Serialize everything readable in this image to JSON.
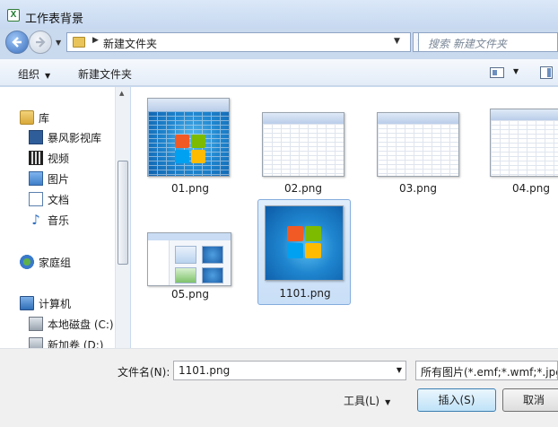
{
  "window": {
    "title": "工作表背景",
    "app_icon_text": "X"
  },
  "address": {
    "path": "新建文件夹",
    "search_placeholder": "搜索 新建文件夹"
  },
  "toolbar": {
    "organize": "组织",
    "new_folder": "新建文件夹"
  },
  "nav": {
    "library": "库",
    "items": [
      "暴风影视库",
      "视频",
      "图片",
      "文档",
      "音乐"
    ],
    "homegroup": "家庭组",
    "computer": "计算机",
    "drives": [
      "本地磁盘 (C:)",
      "新加卷 (D:)"
    ]
  },
  "files": [
    {
      "name": "01.png",
      "kind": "excel-windows"
    },
    {
      "name": "02.png",
      "kind": "excel"
    },
    {
      "name": "03.png",
      "kind": "excel"
    },
    {
      "name": "04.png",
      "kind": "excel"
    },
    {
      "name": "05.png",
      "kind": "explorer"
    },
    {
      "name": "1101.png",
      "kind": "windows",
      "selected": true
    }
  ],
  "bottom": {
    "filename_label": "文件名(N):",
    "filename_value": "1101.png",
    "filetype": "所有图片(*.emf;*.wmf;*.jpg;*.jpeg",
    "tools": "工具(L)",
    "insert": "插入(S)",
    "cancel": "取消"
  },
  "colors": {
    "accent": "#3c7fb1",
    "selection": "#c9dff7",
    "window_frame": "#c9d9ee"
  }
}
